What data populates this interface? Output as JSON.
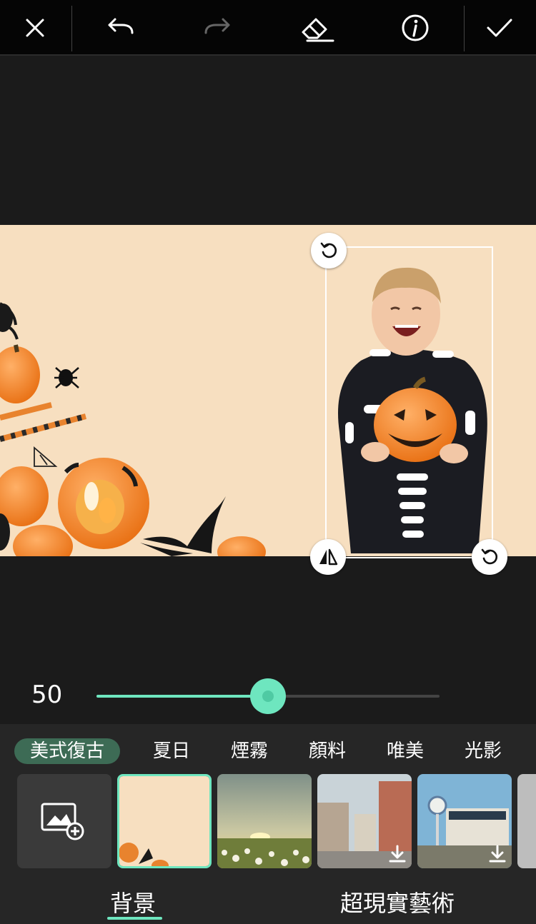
{
  "toolbar": {
    "close_icon": "close-icon",
    "undo_icon": "undo-icon",
    "redo_icon": "redo-icon",
    "eraser_icon": "eraser-icon",
    "info_icon": "info-icon",
    "confirm_icon": "check-icon"
  },
  "slider": {
    "value_label": "50",
    "fraction": 0.5,
    "accent": "#6ee6bf"
  },
  "categories": [
    {
      "label": "美式復古",
      "active": true
    },
    {
      "label": "夏日",
      "active": false
    },
    {
      "label": "煙霧",
      "active": false
    },
    {
      "label": "顏料",
      "active": false
    },
    {
      "label": "唯美",
      "active": false
    },
    {
      "label": "光影",
      "active": false
    }
  ],
  "thumbnails": [
    {
      "kind": "add-photo",
      "icon": "add-image-icon"
    },
    {
      "kind": "halloween-backdrop",
      "selected": true
    },
    {
      "kind": "flower-field-sunset"
    },
    {
      "kind": "old-town-street",
      "download": true
    },
    {
      "kind": "garage",
      "download": true
    }
  ],
  "tabs": [
    {
      "label": "背景",
      "active": true
    },
    {
      "label": "超現實藝術",
      "active": false
    }
  ],
  "colors": {
    "canvas_bg": "#f7dfc0",
    "toolbar_bg": "#050505",
    "panel_bg": "#262626",
    "accent": "#6ee6bf",
    "active_chip": "#3d6b55"
  }
}
